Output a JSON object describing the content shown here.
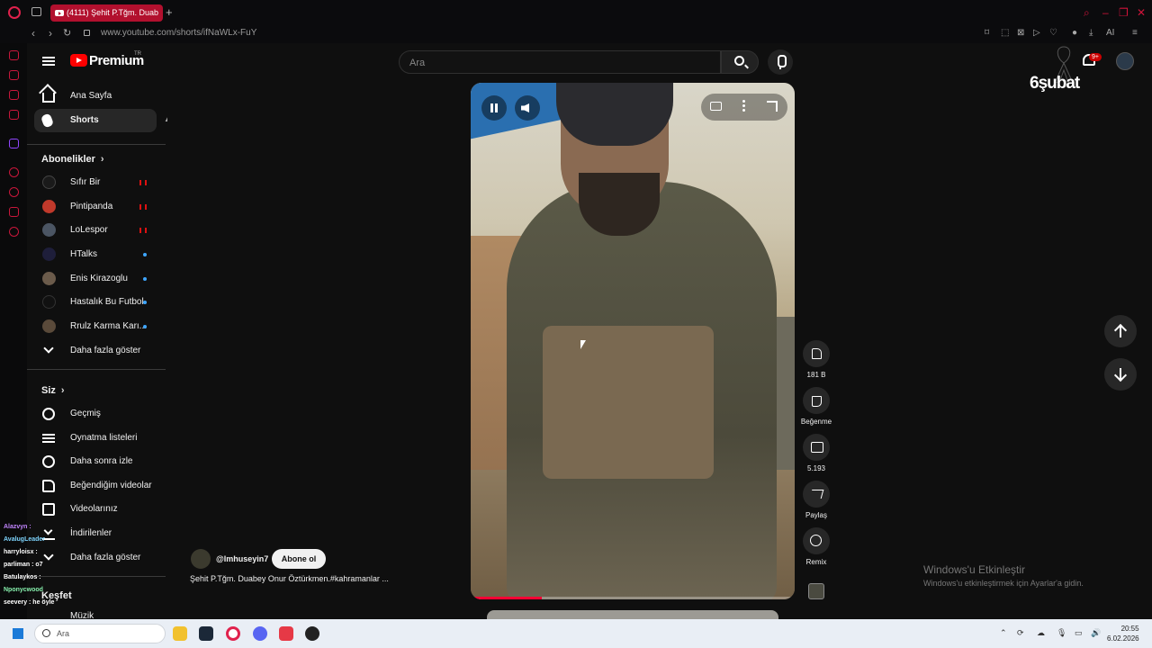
{
  "browser": {
    "tab_title": "(4111) Şehit P.Tğm. Duab",
    "url": "www.youtube.com/shorts/ifNaWLx-FuY",
    "extensions": [
      "AI"
    ]
  },
  "header": {
    "logo_text": "Premium",
    "region": "TR",
    "search_placeholder": "Ara",
    "notification_badge": "9+",
    "event_text": "6şubat"
  },
  "sidebar": {
    "main": [
      {
        "label": "Ana Sayfa",
        "icon": "home-icon"
      },
      {
        "label": "Shorts",
        "icon": "shorts-icon",
        "active": true
      }
    ],
    "subscriptions_title": "Abonelikler",
    "subscriptions": [
      {
        "label": "Sıfır Bir",
        "status": "live"
      },
      {
        "label": "Pintipanda",
        "status": "live"
      },
      {
        "label": "LoLespor",
        "status": "live"
      },
      {
        "label": "HTalks",
        "status": "new"
      },
      {
        "label": "Enis Kirazoglu",
        "status": "new"
      },
      {
        "label": "Hastalık Bu Futbol",
        "status": "new"
      },
      {
        "label": "Rrulz Karma Karı...",
        "status": "new"
      }
    ],
    "show_more_1": "Daha fazla göster",
    "you_title": "Siz",
    "you_items": [
      {
        "label": "Geçmiş",
        "icon": "history-icon"
      },
      {
        "label": "Oynatma listeleri",
        "icon": "playlist-icon"
      },
      {
        "label": "Daha sonra izle",
        "icon": "clock-icon"
      },
      {
        "label": "Beğendiğim videolar",
        "icon": "thumb-up-icon"
      },
      {
        "label": "Videolarınız",
        "icon": "video-icon"
      },
      {
        "label": "İndirilenler",
        "icon": "download-icon"
      }
    ],
    "show_more_2": "Daha fazla göster",
    "explore_title": "Keşfet",
    "explore_first": "Müzik"
  },
  "short": {
    "channel": "@lmhuseyin7",
    "subscribe_label": "Abone ol",
    "title": "Şehit P.Tğm. Duabey Onur Öztürkmen.#kahramanlar ...",
    "progress": 0.22,
    "likes": "181 B",
    "dislike_label": "Beğenme",
    "comments": "5.193",
    "share_label": "Paylaş",
    "remix_label": "Remix"
  },
  "watermark": {
    "line1": "Windows'u Etkinleştir",
    "line2": "Windows'u etkinleştirmek için Ayarlar'a gidin."
  },
  "chat": [
    {
      "text": "Alazvyn : ",
      "color": "#c084fc"
    },
    {
      "text": "AvalugLeader",
      "color": "#7dd3fc"
    },
    {
      "text": "harryloisx :",
      "color": "#ffffff"
    },
    {
      "text": "parliman : o7",
      "color": "#ffffff"
    },
    {
      "text": "Batulaykos :",
      "color": "#ffffff"
    },
    {
      "text": "Nponycwood",
      "color": "#86efac"
    },
    {
      "text": "seevery : he öyle",
      "color": "#ffffff"
    }
  ],
  "taskbar": {
    "search_placeholder": "Ara",
    "time": "20:55",
    "date": "6.02.2026"
  }
}
